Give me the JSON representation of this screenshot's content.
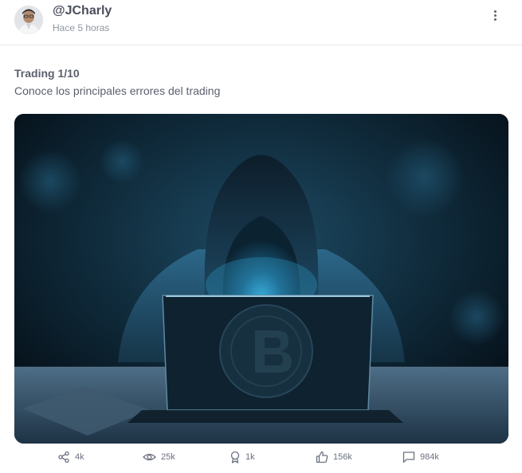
{
  "post": {
    "author": "@JCharly",
    "time": "Hace 5 horas",
    "title": "Trading 1/10",
    "subtitle": "Conoce los principales errores del trading"
  },
  "icons": {
    "more": "more-vertical-icon",
    "share": "share-icon",
    "views": "eye-icon",
    "awards": "award-icon",
    "likes": "thumbs-up-icon",
    "comments": "comment-icon"
  },
  "stats": {
    "shares": "4k",
    "views": "25k",
    "awards": "1k",
    "likes": "156k",
    "comments": "984k"
  },
  "colors": {
    "text": "#5a5f6c",
    "muted": "#9096a3",
    "icon": "#6b7080",
    "image_bg": "#0a1620"
  }
}
